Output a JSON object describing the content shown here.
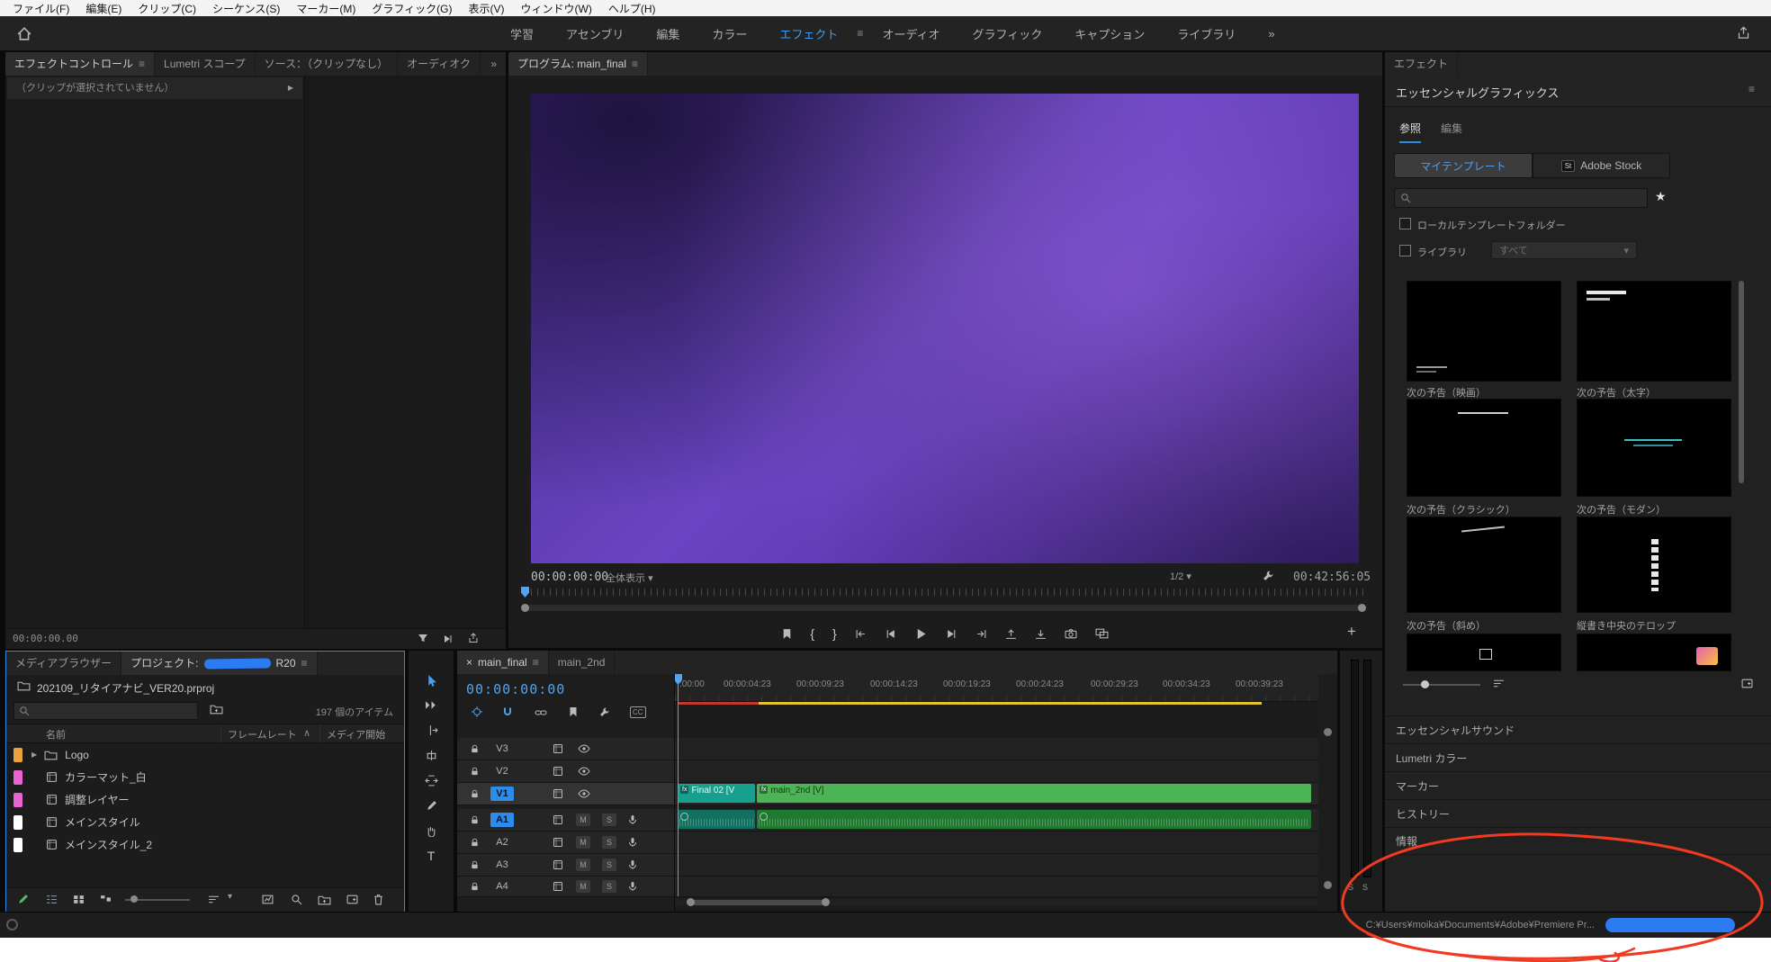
{
  "colors": {
    "accent_blue": "#2d8ceb",
    "timecode_blue": "#52a4f0",
    "render_red": "#c03a2b",
    "render_yellow": "#e3c62e",
    "redaction_blue": "#2b7bf3",
    "annotation_red": "#f13a22"
  },
  "menubar": {
    "items": [
      "ファイル(F)",
      "編集(E)",
      "クリップ(C)",
      "シーケンス(S)",
      "マーカー(M)",
      "グラフィック(G)",
      "表示(V)",
      "ウィンドウ(W)",
      "ヘルプ(H)"
    ]
  },
  "workspace": {
    "tabs": [
      "学習",
      "アセンブリ",
      "編集",
      "カラー",
      "エフェクト",
      "オーディオ",
      "グラフィック",
      "キャプション",
      "ライブラリ"
    ],
    "overflow": "»",
    "menu_icon": "≡"
  },
  "source_panel": {
    "tabs": [
      "エフェクトコントロール",
      "Lumetri スコープ",
      "ソース：（クリップなし）",
      "オーディオク"
    ],
    "overflow": "»",
    "menu_icon": "≡",
    "empty_message": "（クリップが選択されていません）",
    "expand_icon": "▶",
    "timecode": "00:00:00.00"
  },
  "program": {
    "tab": "プログラム: main_final",
    "menu_icon": "≡",
    "timecode": "00:00:00:00",
    "fit": "全体表示",
    "caret": "▾",
    "quality": "1/2",
    "duration": "00:42:56:05",
    "mark_in": "{",
    "mark_out": "}",
    "add_button": "+"
  },
  "graphics_panel": {
    "tab": "エフェクト",
    "title": "エッセンシャルグラフィックス",
    "menu_icon": "≡",
    "tab_browse": "参照",
    "tab_edit": "編集",
    "btn_my_templates": "マイテンプレート",
    "btn_adobe_stock": "Adobe Stock",
    "stock_badge": "St",
    "star": "★",
    "checkbox_local": "ローカルテンプレートフォルダー",
    "checkbox_library": "ライブラリ",
    "library_filter": "すべて",
    "filter_caret": "▾",
    "templates": [
      "次の予告（映画）",
      "次の予告（太字）",
      "次の予告（クラシック）",
      "次の予告（モダン）",
      "次の予告（斜め）",
      "縦書き中央のテロップ"
    ],
    "collapsed_panels": [
      "エッセンシャルサウンド",
      "Lumetri カラー",
      "マーカー",
      "ヒストリー",
      "情報"
    ]
  },
  "project_panel": {
    "tab_media_browser": "メディアブラウザー",
    "tab_project_prefix": "プロジェクト:",
    "tab_project_suffix": "R20",
    "menu_icon": "≡",
    "file_name": "202109_リタイアナビ_VER20.prproj",
    "item_count": "197 個のアイテム",
    "col_name": "名前",
    "col_framerate": "フレームレート",
    "col_media_start": "メディア開始",
    "sort_caret": "∧",
    "rows": [
      {
        "name": "Logo",
        "chip": "#e8a33d"
      },
      {
        "name": "カラーマット_白",
        "chip": "#ea64d0"
      },
      {
        "name": "調整レイヤー",
        "chip": "#ea64d0"
      },
      {
        "name": "メインスタイル",
        "chip": "#ffffff"
      },
      {
        "name": "メインスタイル_2",
        "chip": "#ffffff"
      }
    ]
  },
  "tools": {
    "type_label": "T"
  },
  "timeline": {
    "close": "×",
    "tab_active": "main_final",
    "tab_inactive": "main_2nd",
    "menu_icon": "≡",
    "timecode": "00:00:00:00",
    "cc_label": "CC",
    "ruler": [
      ":00:00",
      "00:00:04:23",
      "00:00:09:23",
      "00:00:14:23",
      "00:00:19:23",
      "00:00:24:23",
      "00:00:29:23",
      "00:00:34:23",
      "00:00:39:23"
    ],
    "video_tracks": [
      "V3",
      "V2",
      "V1"
    ],
    "audio_tracks": [
      "A1",
      "A2",
      "A3",
      "A4"
    ],
    "mute": "M",
    "solo": "S",
    "fx": "fx",
    "clips": {
      "v1": [
        {
          "label": "Final 02 [V",
          "color": "#18a08e"
        },
        {
          "label": "main_2nd [V]",
          "color": "#4cb455"
        }
      ],
      "a1": [
        {
          "color": "#11705f"
        },
        {
          "color": "#1f7a30"
        }
      ]
    }
  },
  "meters": {
    "solo_left": "S",
    "solo_right": "S"
  },
  "status_bar": {
    "path": "C:¥Users¥moika¥Documents¥Adobe¥Premiere Pr..."
  }
}
